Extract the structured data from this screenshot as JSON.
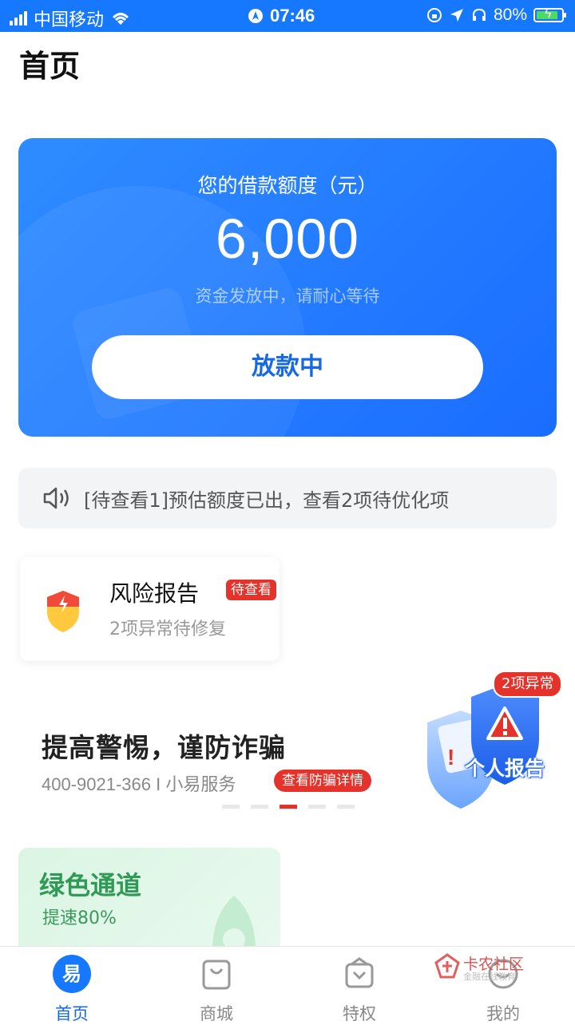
{
  "status_bar": {
    "carrier": "中国移动",
    "time": "07:46",
    "battery": "80%"
  },
  "page_title": "首页",
  "loan_card": {
    "label": "您的借款额度（元）",
    "amount": "6,000",
    "subtitle": "资金发放中，请耐心等待",
    "button": "放款中"
  },
  "notice": {
    "text": "[待查看1]预估额度已出，查看2项待优化项"
  },
  "risk_card": {
    "title": "风险报告",
    "badge": "待查看",
    "subtitle": "2项异常待修复"
  },
  "banner": {
    "title": "提高警惕，谨防诈骗",
    "contact": "400-9021-366 I 小易服务",
    "tag": "查看防骗详情",
    "anomaly_badge": "2项异常",
    "report_label": "个人报告",
    "active_dot": 3,
    "dot_count": 5
  },
  "green_card": {
    "title": "绿色通道",
    "subtitle": "提速80%"
  },
  "tabbar": {
    "items": [
      {
        "label": "首页",
        "active": true,
        "icon": "home-logo-icon"
      },
      {
        "label": "商城",
        "active": false,
        "icon": "shopping-bag-icon"
      },
      {
        "label": "特权",
        "active": false,
        "icon": "privilege-box-icon"
      },
      {
        "label": "我的",
        "active": false,
        "icon": "profile-icon"
      }
    ]
  },
  "watermark": {
    "text": "卡农社区",
    "sub": "金融在线教育"
  },
  "colors": {
    "brand_blue": "#1677ff",
    "alert_red": "#e5322b",
    "green": "#2f9a55"
  }
}
